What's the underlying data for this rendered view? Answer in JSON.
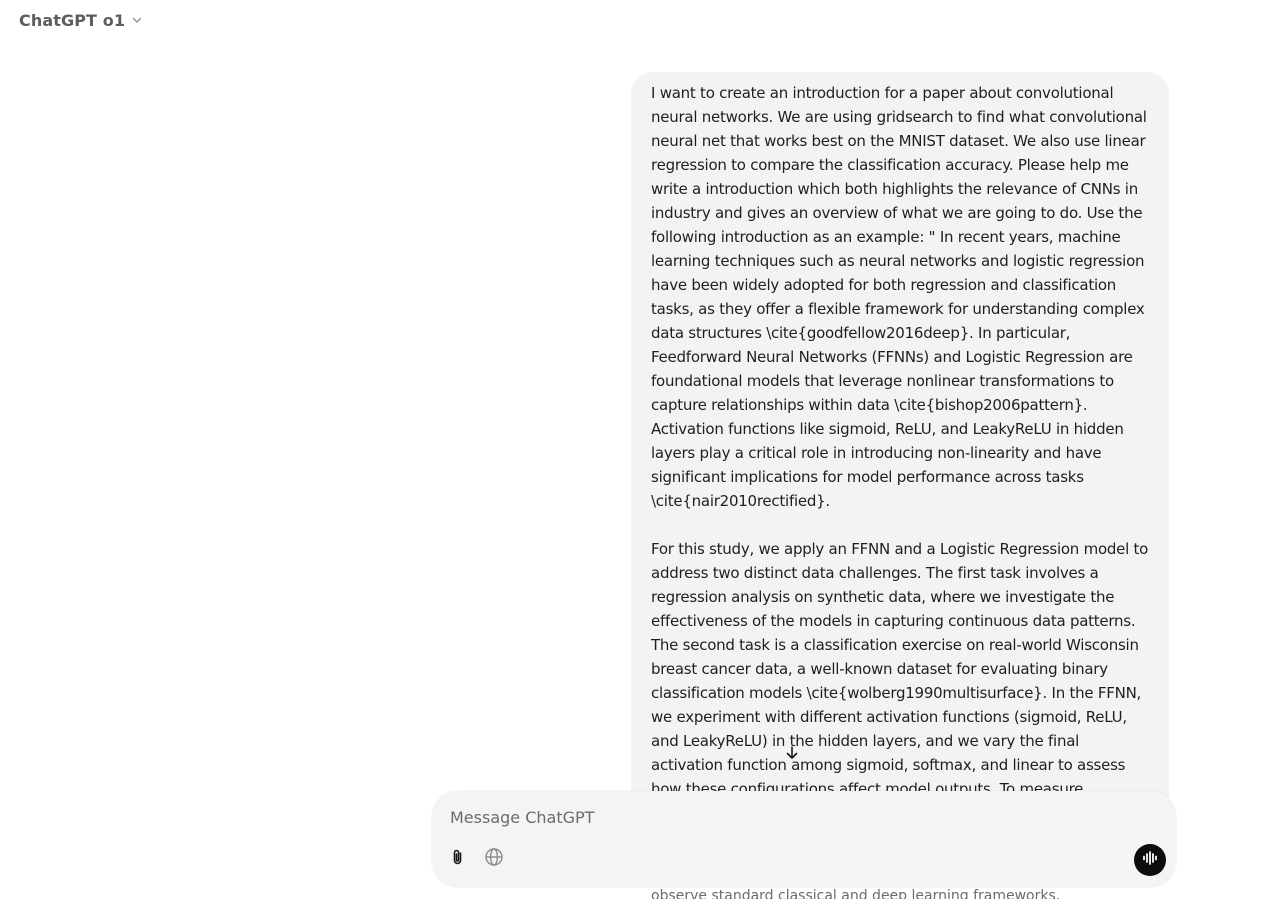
{
  "header": {
    "model_title": "ChatGPT o1",
    "chevron_icon": "chevron-down-icon"
  },
  "conversation": {
    "user_message": {
      "paragraphs": [
        "I want to create an introduction for a paper about convolutional neural networks. We are using gridsearch to find what convolutional neural net that works best on the MNIST dataset. We also use linear regression to compare the classification accuracy. Please help me write a introduction which both highlights the relevance of CNNs in industry and gives an overview of what we are going to do. Use the following introduction as an example: \" In recent years, machine learning techniques such as neural networks and logistic regression have been widely adopted for both regression and classification tasks, as they offer a flexible framework for understanding complex data structures \\cite{goodfellow2016deep}. In particular, Feedforward Neural Networks (FFNNs) and Logistic Regression are foundational models that leverage nonlinear transformations to capture relationships within data \\cite{bishop2006pattern}. Activation functions like sigmoid, ReLU, and LeakyReLU in hidden layers play a critical role in introducing non-linearity and have significant implications for model performance across tasks \\cite{nair2010rectified}.",
        "For this study, we apply an FFNN and a Logistic Regression model to address two distinct data challenges. The first task involves a regression analysis on synthetic data, where we investigate the effectiveness of the models in capturing continuous data patterns. The second task is a classification exercise on real-world Wisconsin breast cancer data, a well-known dataset for evaluating binary classification models \\cite{wolberg1990multisurface}. In the FFNN, we experiment with different activation functions (sigmoid, ReLU, and LeakyReLU) in the hidden layers, and we vary the final activation function among sigmoid, softmax, and linear to assess how these configurations affect model outputs. To measure performance, we"
      ]
    },
    "partial_next_line": "observe standard classical and deep learning frameworks,",
    "scroll_down_icon": "arrow-down-icon"
  },
  "composer": {
    "placeholder": "Message ChatGPT",
    "value": "",
    "attach_icon": "paperclip-icon",
    "search_icon": "globe-icon",
    "voice_icon": "voice-waveform-icon"
  },
  "colors": {
    "bubble_bg": "#f3f3f3",
    "composer_bg": "#f4f4f4",
    "voice_button_bg": "#0d0d0d",
    "muted_text": "#5d5d5d"
  }
}
